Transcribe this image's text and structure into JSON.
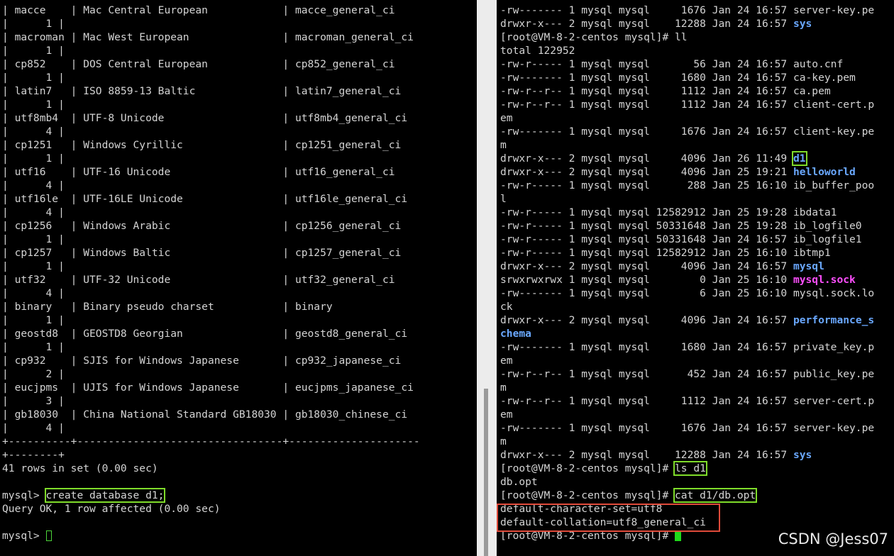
{
  "left_terminal": {
    "lines": [
      "| macce    | Mac Central European            | macce_general_ci",
      "|      1 |",
      "| macroman | Mac West European               | macroman_general_ci",
      "|      1 |",
      "| cp852    | DOS Central European            | cp852_general_ci",
      "|      1 |",
      "| latin7   | ISO 8859-13 Baltic              | latin7_general_ci",
      "|      1 |",
      "| utf8mb4  | UTF-8 Unicode                   | utf8mb4_general_ci",
      "|      4 |",
      "| cp1251   | Windows Cyrillic                | cp1251_general_ci",
      "|      1 |",
      "| utf16    | UTF-16 Unicode                  | utf16_general_ci",
      "|      4 |",
      "| utf16le  | UTF-16LE Unicode                | utf16le_general_ci",
      "|      4 |",
      "| cp1256   | Windows Arabic                  | cp1256_general_ci",
      "|      1 |",
      "| cp1257   | Windows Baltic                  | cp1257_general_ci",
      "|      1 |",
      "| utf32    | UTF-32 Unicode                  | utf32_general_ci",
      "|      4 |",
      "| binary   | Binary pseudo charset           | binary",
      "|      1 |",
      "| geostd8  | GEOSTD8 Georgian                | geostd8_general_ci",
      "|      1 |",
      "| cp932    | SJIS for Windows Japanese       | cp932_japanese_ci",
      "|      2 |",
      "| eucjpms  | UJIS for Windows Japanese       | eucjpms_japanese_ci",
      "|      3 |",
      "| gb18030  | China National Standard GB18030 | gb18030_chinese_ci",
      "|      4 |",
      "+----------+---------------------------------+---------------------",
      "+--------+",
      "41 rows in set (0.00 sec)",
      ""
    ],
    "prompt1": "mysql> ",
    "command": "create database d1;",
    "result": "Query OK, 1 row affected (0.00 sec)",
    "blank": "",
    "prompt2": "mysql> "
  },
  "right_terminal": {
    "top1": "-rw------- 1 mysql mysql     1676 Jan 24 16:57 server-key.pe",
    "top2_pre": "drwxr-x--- 2 mysql mysql    12288 Jan 24 16:57 ",
    "top2_name": "sys",
    "ll_cmd": "[root@VM-8-2-centos mysql]# ll",
    "total": "total 122952",
    "r1": "-rw-r----- 1 mysql mysql       56 Jan 24 16:57 auto.cnf",
    "r2": "-rw------- 1 mysql mysql     1680 Jan 24 16:57 ca-key.pem",
    "r3": "-rw-r--r-- 1 mysql mysql     1112 Jan 24 16:57 ca.pem",
    "r4": "-rw-r--r-- 1 mysql mysql     1112 Jan 24 16:57 client-cert.p",
    "r4b": "em",
    "r5": "-rw------- 1 mysql mysql     1676 Jan 24 16:57 client-key.pe",
    "r5b": "m",
    "d1_pre": "drwxr-x--- 2 mysql mysql     4096 Jan 26 11:49 ",
    "d1_name": "d1",
    "hw_pre": "drwxr-x--- 2 mysql mysql     4096 Jan 25 19:21 ",
    "hw_name": "helloworld",
    "r6": "-rw-r----- 1 mysql mysql      288 Jan 25 16:10 ib_buffer_poo",
    "r6b": "l",
    "r7": "-rw-r----- 1 mysql mysql 12582912 Jan 25 19:28 ibdata1",
    "r8": "-rw-r----- 1 mysql mysql 50331648 Jan 25 19:28 ib_logfile0",
    "r9": "-rw-r----- 1 mysql mysql 50331648 Jan 24 16:57 ib_logfile1",
    "r10": "-rw-r----- 1 mysql mysql 12582912 Jan 25 16:10 ibtmp1",
    "mysql_pre": "drwxr-x--- 2 mysql mysql     4096 Jan 24 16:57 ",
    "mysql_name": "mysql",
    "sock_pre": "srwxrwxrwx 1 mysql mysql        0 Jan 25 16:10 ",
    "sock_name": "mysql.sock",
    "r11": "-rw------- 1 mysql mysql        6 Jan 25 16:10 mysql.sock.lo",
    "r11b": "ck",
    "ps_pre": "drwxr-x--- 2 mysql mysql     4096 Jan 24 16:57 ",
    "ps_name": "performance_s",
    "ps_name2": "chema",
    "r12": "-rw------- 1 mysql mysql     1680 Jan 24 16:57 private_key.p",
    "r12b": "em",
    "r13": "-rw-r--r-- 1 mysql mysql      452 Jan 24 16:57 public_key.pe",
    "r13b": "m",
    "r14": "-rw-r--r-- 1 mysql mysql     1112 Jan 24 16:57 server-cert.p",
    "r14b": "em",
    "r15": "-rw------- 1 mysql mysql     1676 Jan 24 16:57 server-key.pe",
    "r15b": "m",
    "sys_pre": "drwxr-x--- 2 mysql mysql    12288 Jan 24 16:57 ",
    "sys_name": "sys",
    "prompt": "[root@VM-8-2-centos mysql]# ",
    "ls_cmd": "ls d1",
    "ls_out": "db.opt",
    "cat_cmd": "cat d1/db.opt",
    "opt1": "default-character-set=utf8",
    "opt2": "default-collation=utf8_general_ci"
  },
  "watermark": "CSDN @Jess07",
  "colors": {
    "dir": "#6aa8ff",
    "socket": "#ff4fff",
    "highlight_green": "#7fdc2a",
    "highlight_red": "#e04a3a"
  }
}
